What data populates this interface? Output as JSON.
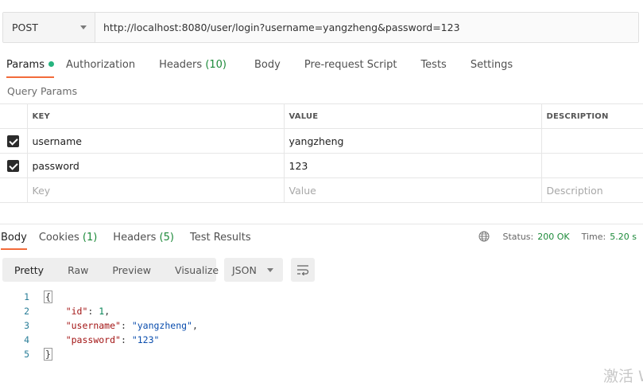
{
  "request": {
    "method": "POST",
    "url": "http://localhost:8080/user/login?username=yangzheng&password=123"
  },
  "request_tabs": [
    {
      "label": "Params",
      "active": true
    },
    {
      "label": "Authorization"
    },
    {
      "label": "Headers",
      "count": "(10)"
    },
    {
      "label": "Body"
    },
    {
      "label": "Pre-request Script"
    },
    {
      "label": "Tests"
    },
    {
      "label": "Settings"
    }
  ],
  "query_params": {
    "title": "Query Params",
    "headers": [
      "KEY",
      "VALUE",
      "DESCRIPTION"
    ],
    "rows": [
      {
        "checked": true,
        "key": "username",
        "value": "yangzheng",
        "description": ""
      },
      {
        "checked": true,
        "key": "password",
        "value": "123",
        "description": ""
      }
    ],
    "placeholders": {
      "key": "Key",
      "value": "Value",
      "description": "Description"
    }
  },
  "response_tabs": [
    {
      "label": "Body",
      "active": true
    },
    {
      "label": "Cookies",
      "count": "(1)"
    },
    {
      "label": "Headers",
      "count": "(5)"
    },
    {
      "label": "Test Results"
    }
  ],
  "response_status": {
    "status_label": "Status:",
    "status_value": "200 OK",
    "time_label": "Time:",
    "time_value": "5.20 s"
  },
  "view_modes": [
    "Pretty",
    "Raw",
    "Preview",
    "Visualize"
  ],
  "format": "JSON",
  "response_body": {
    "line_numbers": [
      "1",
      "2",
      "3",
      "4",
      "5"
    ],
    "open_brace": "{",
    "close_brace": "}",
    "fields": [
      {
        "key": "\"id\"",
        "value": "1",
        "type": "number"
      },
      {
        "key": "\"username\"",
        "value": "\"yangzheng\"",
        "type": "string"
      },
      {
        "key": "\"password\"",
        "value": "\"123\"",
        "type": "string"
      }
    ]
  },
  "watermark": "激活 W",
  "colors": {
    "accent": "#f26b3a",
    "success": "#1d8a3a",
    "dot": "#26b47f"
  }
}
